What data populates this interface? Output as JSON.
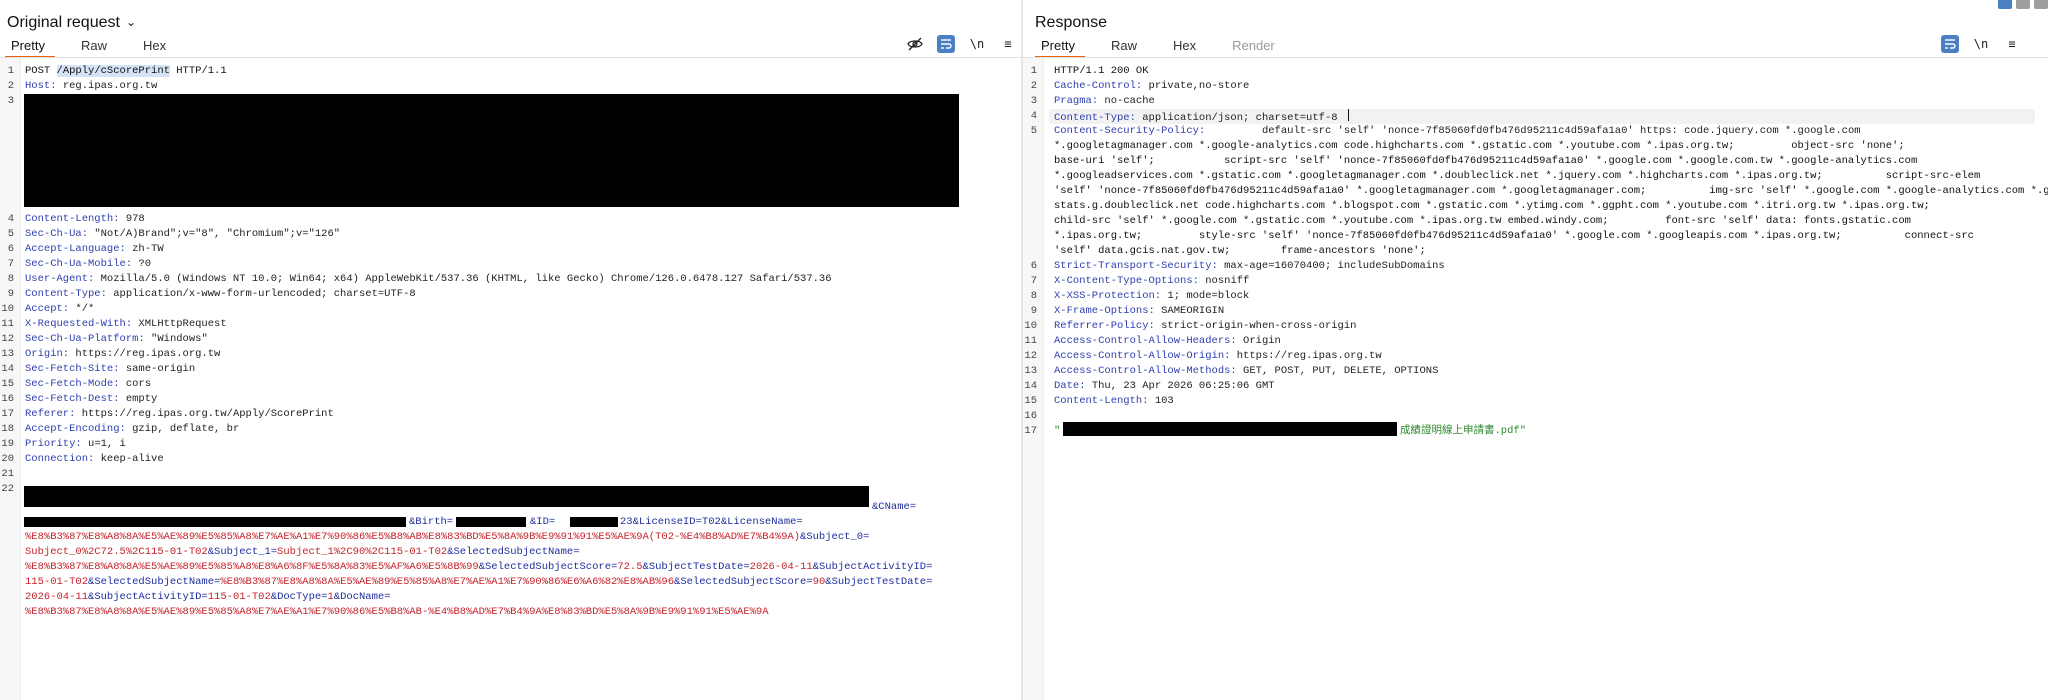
{
  "request": {
    "title": "Original request",
    "tabs": [
      "Pretty",
      "Raw",
      "Hex"
    ],
    "tools": {
      "hide": "eye-off-icon",
      "wrap": "wrap-icon",
      "newline": "\\n",
      "menu": "≡"
    },
    "lines": {
      "l1_method": "POST ",
      "l1_path": "/Apply/cScorePrint",
      "l1_proto": " HTTP/1.1",
      "l2_k": "Host:",
      "l2_v": " reg.ipas.org.tw",
      "l4_k": "Content-Length:",
      "l4_v": " 978",
      "l5_k": "Sec-Ch-Ua:",
      "l5_v": " \"Not/A)Brand\";v=\"8\", \"Chromium\";v=\"126\"",
      "l6_k": "Accept-Language:",
      "l6_v": " zh-TW",
      "l7_k": "Sec-Ch-Ua-Mobile:",
      "l7_v": " ?0",
      "l8_k": "User-Agent:",
      "l8_v": " Mozilla/5.0 (Windows NT 10.0; Win64; x64) AppleWebKit/537.36 (KHTML, like Gecko) Chrome/126.0.6478.127 Safari/537.36",
      "l9_k": "Content-Type:",
      "l9_v": " application/x-www-form-urlencoded; charset=UTF-8",
      "l10_k": "Accept:",
      "l10_v": " */*",
      "l11_k": "X-Requested-With:",
      "l11_v": " XMLHttpRequest",
      "l12_k": "Sec-Ch-Ua-Platform:",
      "l12_v": " \"Windows\"",
      "l13_k": "Origin:",
      "l13_v": " https://reg.ipas.org.tw",
      "l14_k": "Sec-Fetch-Site:",
      "l14_v": " same-origin",
      "l15_k": "Sec-Fetch-Mode:",
      "l15_v": " cors",
      "l16_k": "Sec-Fetch-Dest:",
      "l16_v": " empty",
      "l17_k": "Referer:",
      "l17_v": " https://reg.ipas.org.tw/Apply/ScorePrint",
      "l18_k": "Accept-Encoding:",
      "l18_v": " gzip, deflate, br",
      "l19_k": "Priority:",
      "l19_v": " u=1, i",
      "l20_k": "Connection:",
      "l20_v": " keep-alive",
      "b1_tail": "&CName=",
      "b2_birth": "&Birth=",
      "b2_id": "&ID=",
      "b2_tail": "23&LicenseID=T02&LicenseName=",
      "b3_a": "%E8%B3%87%E8%A8%8A%E5%AE%89%E5%85%A8%E7%AE%A1%E7%90%86%E5%B8%AB%E8%83%BD%E5%8A%9B%E9%91%91%E5%AE%9A(T02-%E4%B8%AD%E7%B4%9A)",
      "b3_b": "&Subject_0=",
      "b4_a": "Subject_0%2C72.5%2C115-01-T02",
      "b4_b": "&Subject_1=",
      "b4_c": "Subject_1%2C90%2C115-01-T02",
      "b4_d": "&SelectedSubjectName=",
      "b5_a": "%E8%B3%87%E8%A8%8A%E5%AE%89%E5%85%A8%E8%A6%8F%E5%8A%83%E5%AF%A6%E5%8B%99",
      "b5_b": "&SelectedSubjectScore=",
      "b5_c": "72.5",
      "b5_d": "&SubjectTestDate=",
      "b5_e": "2026-04-11",
      "b5_f": "&SubjectActivityID=",
      "b6_a": "115-01-T02",
      "b6_b": "&SelectedSubjectName=",
      "b6_c": "%E8%B3%87%E8%A8%8A%E5%AE%89%E5%85%A8%E7%AE%A1%E7%90%86%E6%A6%82%E8%AB%96",
      "b6_d": "&SelectedSubjectScore=",
      "b6_e": "90",
      "b6_f": "&SubjectTestDate=",
      "b7_a": "2026-04-11",
      "b7_b": "&SubjectActivityID=",
      "b7_c": "115-01-T02",
      "b7_d": "&DocType=",
      "b7_e": "1",
      "b7_f": "&DocName=",
      "b8_a": "%E8%B3%87%E8%A8%8A%E5%AE%89%E5%85%A8%E7%AE%A1%E7%90%86%E5%B8%AB-%E4%B8%AD%E7%B4%9A%E8%83%BD%E5%8A%9B%E9%91%91%E5%AE%9A"
    }
  },
  "response": {
    "title": "Response",
    "tabs": [
      "Pretty",
      "Raw",
      "Hex",
      "Render"
    ],
    "tools": {
      "wrap": "wrap-icon",
      "newline": "\\n",
      "menu": "≡"
    },
    "lines": {
      "l1": "HTTP/1.1 200 OK",
      "l2_k": "Cache-Control:",
      "l2_v": " private,no-store",
      "l3_k": "Pragma:",
      "l3_v": " no-cache",
      "l4_k": "Content-Type:",
      "l4_v": " application/json; charset=utf-8",
      "l5_k": "Content-Security-Policy:",
      "l5_v": "         default-src 'self' 'nonce-7f85060fd0fb476d95211c4d59afa1a0' https: code.jquery.com *.google.com",
      "l5_c2": "*.googletagmanager.com *.google-analytics.com code.highcharts.com *.gstatic.com *.youtube.com *.ipas.org.tw;         object-src 'none';",
      "l5_c3": "base-uri 'self';           script-src 'self' 'nonce-7f85060fd0fb476d95211c4d59afa1a0' *.google.com *.google.com.tw *.google-analytics.com",
      "l5_c4": "*.googleadservices.com *.gstatic.com *.googletagmanager.com *.doubleclick.net *.jquery.com *.highcharts.com *.ipas.org.tw;          script-src-elem",
      "l5_c5": "'self' 'nonce-7f85060fd0fb476d95211c4d59afa1a0' *.googletagmanager.com *.googletagmanager.com;          img-src 'self' *.google.com *.google-analytics.com *.googleapis.com",
      "l5_c6": "stats.g.doubleclick.net code.highcharts.com *.blogspot.com *.gstatic.com *.ytimg.com *.ggpht.com *.youtube.com *.itri.org.tw *.ipas.org.tw;",
      "l5_c7": "child-src 'self' *.google.com *.gstatic.com *.youtube.com *.ipas.org.tw embed.windy.com;         font-src 'self' data: fonts.gstatic.com",
      "l5_c8": "*.ipas.org.tw;         style-src 'self' 'nonce-7f85060fd0fb476d95211c4d59afa1a0' *.google.com *.googleapis.com *.ipas.org.tw;          connect-src",
      "l5_c9": "'self' data.gcis.nat.gov.tw;        frame-ancestors 'none';",
      "l6_k": "Strict-Transport-Security:",
      "l6_v": " max-age=16070400; includeSubDomains",
      "l7_k": "X-Content-Type-Options:",
      "l7_v": " nosniff",
      "l8_k": "X-XSS-Protection:",
      "l8_v": " 1; mode=block",
      "l9_k": "X-Frame-Options:",
      "l9_v": " SAMEORIGIN",
      "l10_k": "Referrer-Policy:",
      "l10_v": " strict-origin-when-cross-origin",
      "l11_k": "Access-Control-Allow-Headers:",
      "l11_v": " Origin",
      "l12_k": "Access-Control-Allow-Origin:",
      "l12_v": " https://reg.ipas.org.tw",
      "l13_k": "Access-Control-Allow-Methods:",
      "l13_v": " GET, POST, PUT, DELETE, OPTIONS",
      "l14_k": "Date:",
      "l14_v": " Thu, 23 Apr 2026 06:25:06 GMT",
      "l15_k": "Content-Length:",
      "l15_v": " 103",
      "l17_open": "\"",
      "l17_str": "成績證明線上申請書.pdf\""
    }
  }
}
